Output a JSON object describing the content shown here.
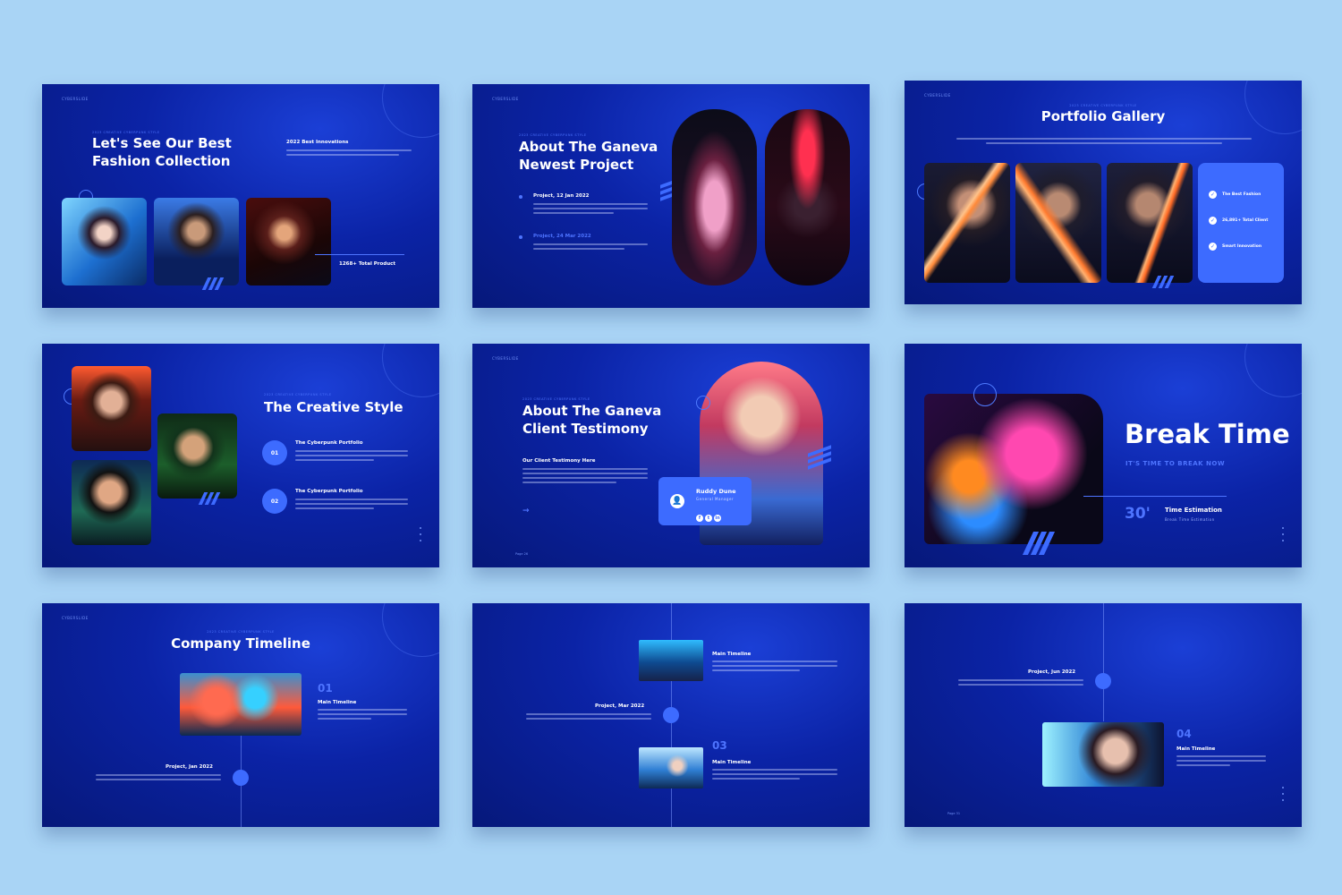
{
  "brand": "CYBERSLIDE",
  "kicker": "2023 CREATIVE CYBERPUNK STYLE",
  "s1": {
    "title": "Let's See Our Best\nFashion Collection",
    "side_title": "2022 Best Innovations",
    "stat": "1268+ Total Product"
  },
  "s2": {
    "title": "About The Ganeva\nNewest Project",
    "item1": "Project, 12 Jan 2022",
    "item2": "Project, 24 Mar 2022"
  },
  "s3": {
    "title": "Portfolio Gallery",
    "features": [
      "The Best Fashion",
      "26,891+ Total Client",
      "Smart Innovation"
    ],
    "check_icon": "✓"
  },
  "s4": {
    "title": "The Creative Style",
    "n1": "01",
    "h1": "The Cyberpunk Portfolio",
    "n2": "02",
    "h2": "The Cyberpunk Portfolio"
  },
  "s5": {
    "title": "About The Ganeva\nClient Testimony",
    "sub": "Our Client Testimony Here",
    "arrow": "→",
    "name": "Ruddy Dune",
    "role": "General Manager",
    "page": "Page 26",
    "avatar_icon": "👤",
    "socials": [
      "f",
      "t",
      "in"
    ]
  },
  "s6": {
    "title": "Break Time",
    "subtitle": "IT'S TIME TO BREAK NOW",
    "num": "30'",
    "label": "Time Estimation",
    "desc": "Break Time Estimation"
  },
  "s7": {
    "title": "Company Timeline",
    "num": "01",
    "main": "Main Timeline",
    "proj": "Project, Jan 2022"
  },
  "s8": {
    "main1": "Main Timeline",
    "proj": "Project, Mar 2022",
    "num": "03",
    "main2": "Main Timeline"
  },
  "s9": {
    "proj": "Project, Jun 2022",
    "num": "04",
    "main": "Main Timeline",
    "page": "Page 31"
  },
  "colors": {
    "background": "#a9d4f5",
    "slide": "#0b23a6",
    "accent": "#3d6bff"
  }
}
